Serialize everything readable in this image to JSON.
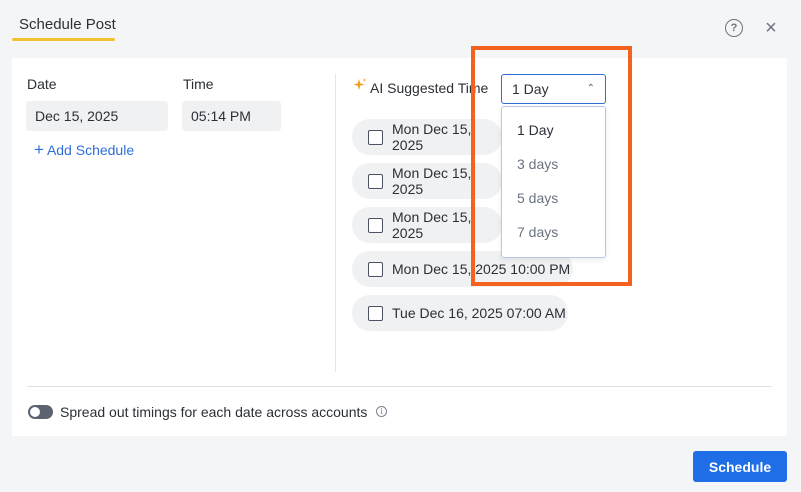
{
  "dialog": {
    "title": "Schedule Post",
    "help_icon": "help-circle-icon",
    "close_icon": "close-icon",
    "close_glyph": "×",
    "help_glyph": "?"
  },
  "left_panel": {
    "date_label": "Date",
    "date_value": "Dec 15, 2025",
    "time_label": "Time",
    "time_value": "05:14 PM",
    "add_schedule_label": "Add Schedule"
  },
  "ai_panel": {
    "label": "AI Suggested Time",
    "select_value": "1 Day",
    "options": [
      "1 Day",
      "3 days",
      "5 days",
      "7 days"
    ],
    "slots": [
      "Mon Dec 15, 2025",
      "Mon Dec 15, 2025",
      "Mon Dec 15, 2025",
      "Mon Dec 15, 2025 10:00 PM",
      "Tue Dec 16, 2025 07:00 AM"
    ]
  },
  "footer": {
    "spread_label": "Spread out timings for each date across accounts",
    "schedule_button": "Schedule"
  },
  "colors": {
    "accent": "#1f6ee8",
    "title_underline": "#f3c130",
    "highlight": "#f4621f",
    "sparkle": "#f0a020"
  }
}
